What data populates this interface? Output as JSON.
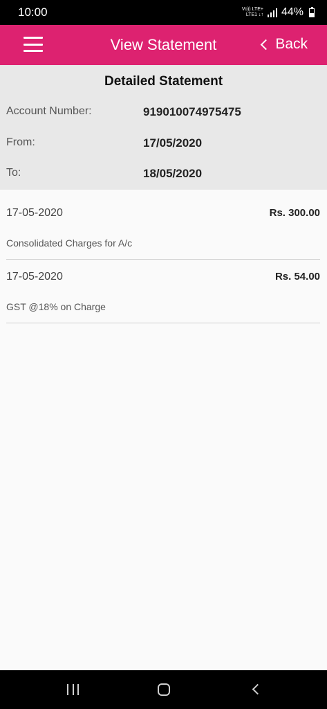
{
  "status_bar": {
    "time": "10:00",
    "net_top": "Vo)) LTE+",
    "net_bottom": "LTE1 ↓↑",
    "battery_percent": "44%"
  },
  "app_bar": {
    "title": "View Statement",
    "back_label": "Back",
    "menu_icon": "hamburger-menu-icon",
    "background_color": "#dd2270"
  },
  "statement": {
    "title": "Detailed Statement",
    "account_label": "Account Number:",
    "account_value": "919010074975475",
    "from_label": "From:",
    "from_value": "17/05/2020",
    "to_label": "To:",
    "to_value": "18/05/2020"
  },
  "transactions": [
    {
      "date": "17-05-2020",
      "amount": "Rs. 300.00",
      "description": "Consolidated Charges for A/c"
    },
    {
      "date": "17-05-2020",
      "amount": "Rs. 54.00",
      "description": "GST @18% on Charge"
    }
  ],
  "nav_bar": {
    "icons": [
      "recents-icon",
      "home-icon",
      "back-icon"
    ]
  }
}
